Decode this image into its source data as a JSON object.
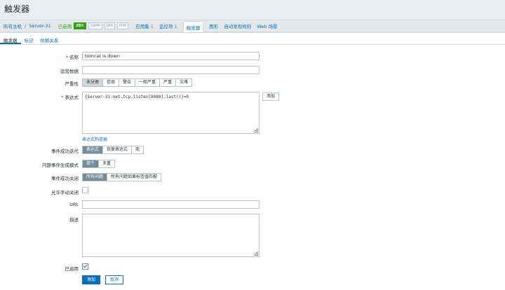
{
  "page": {
    "title": "触发器"
  },
  "breadcrumb": {
    "all_hosts": "所有主机",
    "separator": "/",
    "host": "Server-31",
    "status": "已启用",
    "badges": [
      "ZBX",
      "SNMP",
      "JMX",
      "IPMI"
    ],
    "items": [
      {
        "label": "应用集",
        "count": "1"
      },
      {
        "label": "监控项",
        "count": "1"
      },
      {
        "label": "触发器",
        "count": ""
      },
      {
        "label": "图形",
        "count": ""
      },
      {
        "label": "自动发现规则",
        "count": ""
      },
      {
        "label": "Web 场景",
        "count": ""
      }
    ]
  },
  "tabs": [
    "触发器",
    "标记",
    "依赖关系"
  ],
  "form": {
    "name_label": "名称",
    "name_value": "tomcat is down",
    "event_name_label": "运营数据",
    "severity_label": "严重性",
    "severity_options": [
      "未分类",
      "信息",
      "警告",
      "一般严重",
      "严重",
      "灾难"
    ],
    "expression_label": "表达式",
    "expression_value": "{Server-31:net.tcp.listen[8080].last()}=0",
    "add_label": "添加",
    "expression_builder": "表达式构造器",
    "ok_event_label": "事件成功迭代",
    "ok_event_options": [
      "表达式",
      "恢复表达式",
      "无"
    ],
    "problem_mode_label": "问题事件生成模式",
    "problem_mode_options": [
      "单个",
      "多重"
    ],
    "ok_close_label": "事件成功关闭",
    "ok_close_options": [
      "所有问题",
      "所有问题如果标签值匹配"
    ],
    "manual_close_label": "允许手动关闭",
    "url_label": "URL",
    "description_label": "描述",
    "enabled_label": "已启用",
    "submit_label": "添加",
    "cancel_label": "取消"
  },
  "colors": {
    "accent": "#0b6fb5",
    "enabled": "#2f9e12",
    "required": "#d40000"
  }
}
